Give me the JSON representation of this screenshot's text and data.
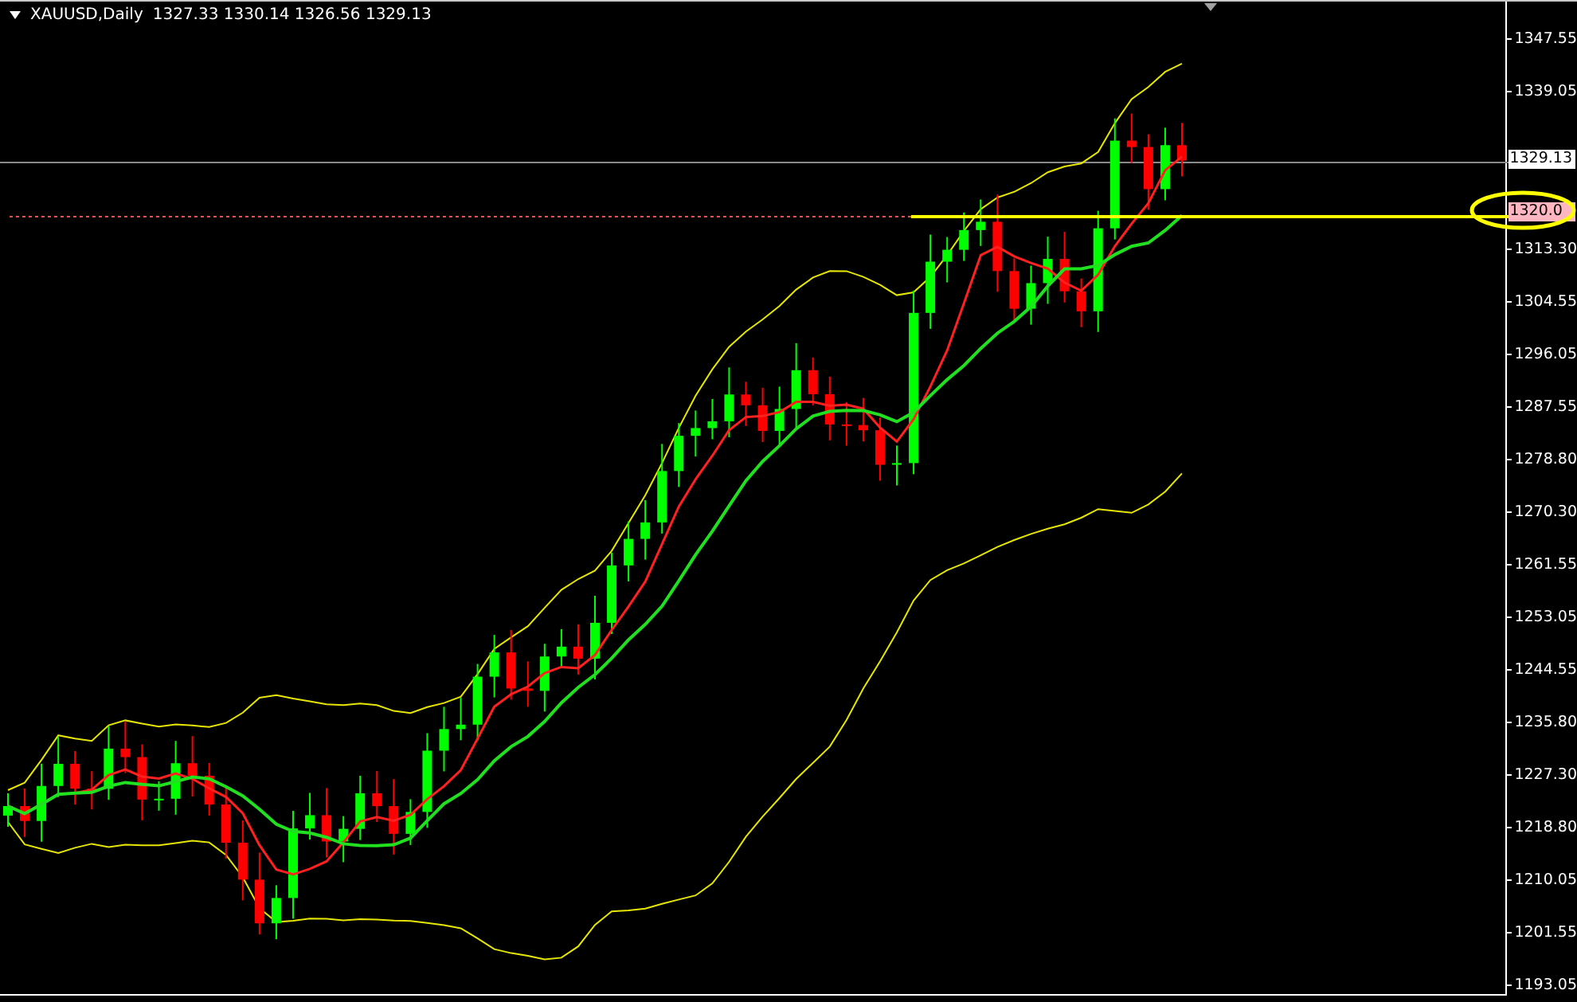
{
  "chart": {
    "symbol": "XAUUSD,Daily",
    "ohlc": "1327.33 1330.14 1326.56 1329.13"
  },
  "price_axis": {
    "labels": [
      "1347.55",
      "1339.05",
      "1313.30",
      "1304.55",
      "1296.05",
      "1287.55",
      "1278.80",
      "1270.30",
      "1261.55",
      "1253.05",
      "1244.55",
      "1235.80",
      "1227.30",
      "1218.80",
      "1210.05",
      "1201.55",
      "1193.05"
    ]
  },
  "price_badges": [
    {
      "kind": "bid",
      "text": "1329.13"
    },
    {
      "kind": "alert",
      "text": "1320.0"
    }
  ]
}
